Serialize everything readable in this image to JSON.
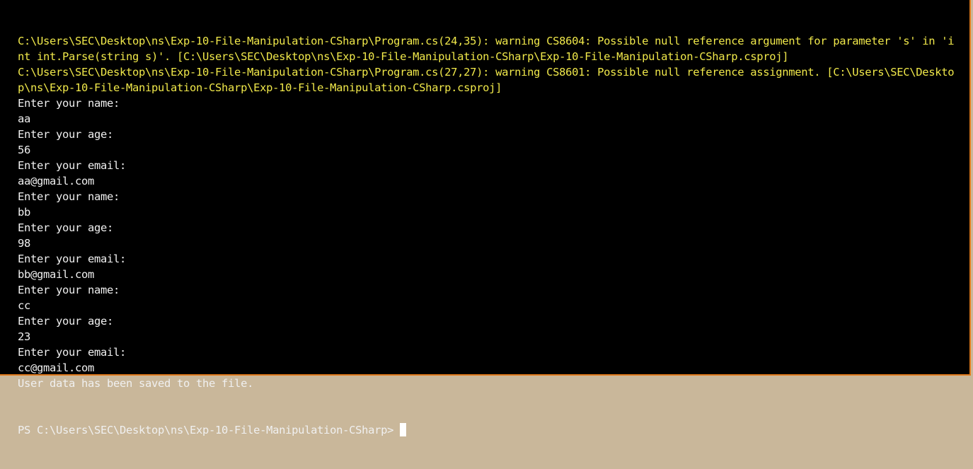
{
  "colors": {
    "background": "#000000",
    "warning_text": "#f0e84a",
    "normal_text": "#f0f0f0",
    "window_border": "#e07a1c"
  },
  "terminal": {
    "lines": [
      {
        "text": "C:\\Users\\SEC\\Desktop\\ns\\Exp-10-File-Manipulation-CSharp\\Program.cs(24,35): warning CS8604: Possible null reference argument for parameter 's' in 'i",
        "kind": "warning"
      },
      {
        "text": "nt int.Parse(string s)'. [C:\\Users\\SEC\\Desktop\\ns\\Exp-10-File-Manipulation-CSharp\\Exp-10-File-Manipulation-CSharp.csproj]",
        "kind": "warning"
      },
      {
        "text": "C:\\Users\\SEC\\Desktop\\ns\\Exp-10-File-Manipulation-CSharp\\Program.cs(27,27): warning CS8601: Possible null reference assignment. [C:\\Users\\SEC\\Deskto",
        "kind": "warning"
      },
      {
        "text": "p\\ns\\Exp-10-File-Manipulation-CSharp\\Exp-10-File-Manipulation-CSharp.csproj]",
        "kind": "warning"
      },
      {
        "text": "Enter your name:",
        "kind": "normal"
      },
      {
        "text": "aa",
        "kind": "normal"
      },
      {
        "text": "Enter your age:",
        "kind": "normal"
      },
      {
        "text": "56",
        "kind": "normal"
      },
      {
        "text": "Enter your email:",
        "kind": "normal"
      },
      {
        "text": "aa@gmail.com",
        "kind": "normal"
      },
      {
        "text": "Enter your name:",
        "kind": "normal"
      },
      {
        "text": "bb",
        "kind": "normal"
      },
      {
        "text": "Enter your age:",
        "kind": "normal"
      },
      {
        "text": "98",
        "kind": "normal"
      },
      {
        "text": "Enter your email:",
        "kind": "normal"
      },
      {
        "text": "bb@gmail.com",
        "kind": "normal"
      },
      {
        "text": "Enter your name:",
        "kind": "normal"
      },
      {
        "text": "cc",
        "kind": "normal"
      },
      {
        "text": "Enter your age:",
        "kind": "normal"
      },
      {
        "text": "23",
        "kind": "normal"
      },
      {
        "text": "Enter your email:",
        "kind": "normal"
      },
      {
        "text": "cc@gmail.com",
        "kind": "normal"
      },
      {
        "text": "User data has been saved to the file.",
        "kind": "normal"
      }
    ],
    "prompt": "PS C:\\Users\\SEC\\Desktop\\ns\\Exp-10-File-Manipulation-CSharp>"
  }
}
